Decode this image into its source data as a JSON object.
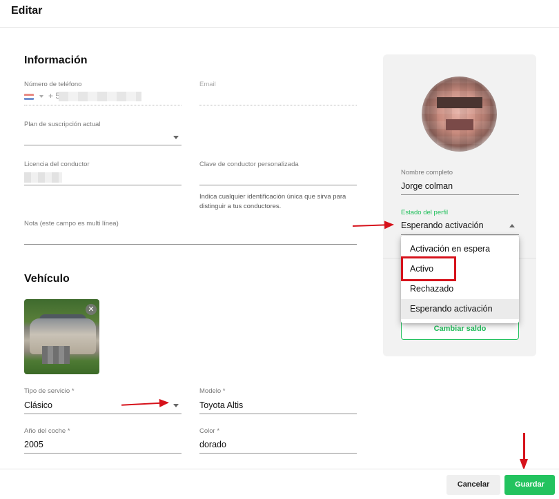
{
  "header": {
    "title": "Editar"
  },
  "info": {
    "title": "Información",
    "phone": {
      "label": "Número de teléfono",
      "prefix": "+ 5"
    },
    "email": {
      "label": "Email"
    },
    "plan": {
      "label": "Plan de suscripción actual"
    },
    "license": {
      "label": "Licencia del conductor"
    },
    "custom_key": {
      "label": "Clave de conductor personalizada",
      "hint": "Indica cualquier identificación única que sirva para distinguir a tus conductores."
    },
    "note": {
      "label": "Nota (este campo es multi línea)"
    }
  },
  "vehicle": {
    "title": "Vehículo",
    "service_type": {
      "label": "Tipo de servicio *",
      "value": "Clásico"
    },
    "model": {
      "label": "Modelo *",
      "value": "Toyota Altis"
    },
    "year": {
      "label": "Año del coche *",
      "value": "2005"
    },
    "color": {
      "label": "Color *",
      "value": "dorado"
    }
  },
  "profile": {
    "full_name": {
      "label": "Nombre completo",
      "value": "Jorge colman"
    },
    "status": {
      "label": "Estado del perfil",
      "value": "Esperando activación"
    },
    "status_options": [
      "Activación en espera",
      "Activo",
      "Rechazado",
      "Esperando activación"
    ],
    "selected_option_index": 3,
    "change_balance_label": "Cambiar saldo"
  },
  "footer": {
    "cancel_label": "Cancelar",
    "save_label": "Guardar"
  },
  "colors": {
    "accent_green": "#23c35f",
    "annotation_red": "#d6121b"
  }
}
